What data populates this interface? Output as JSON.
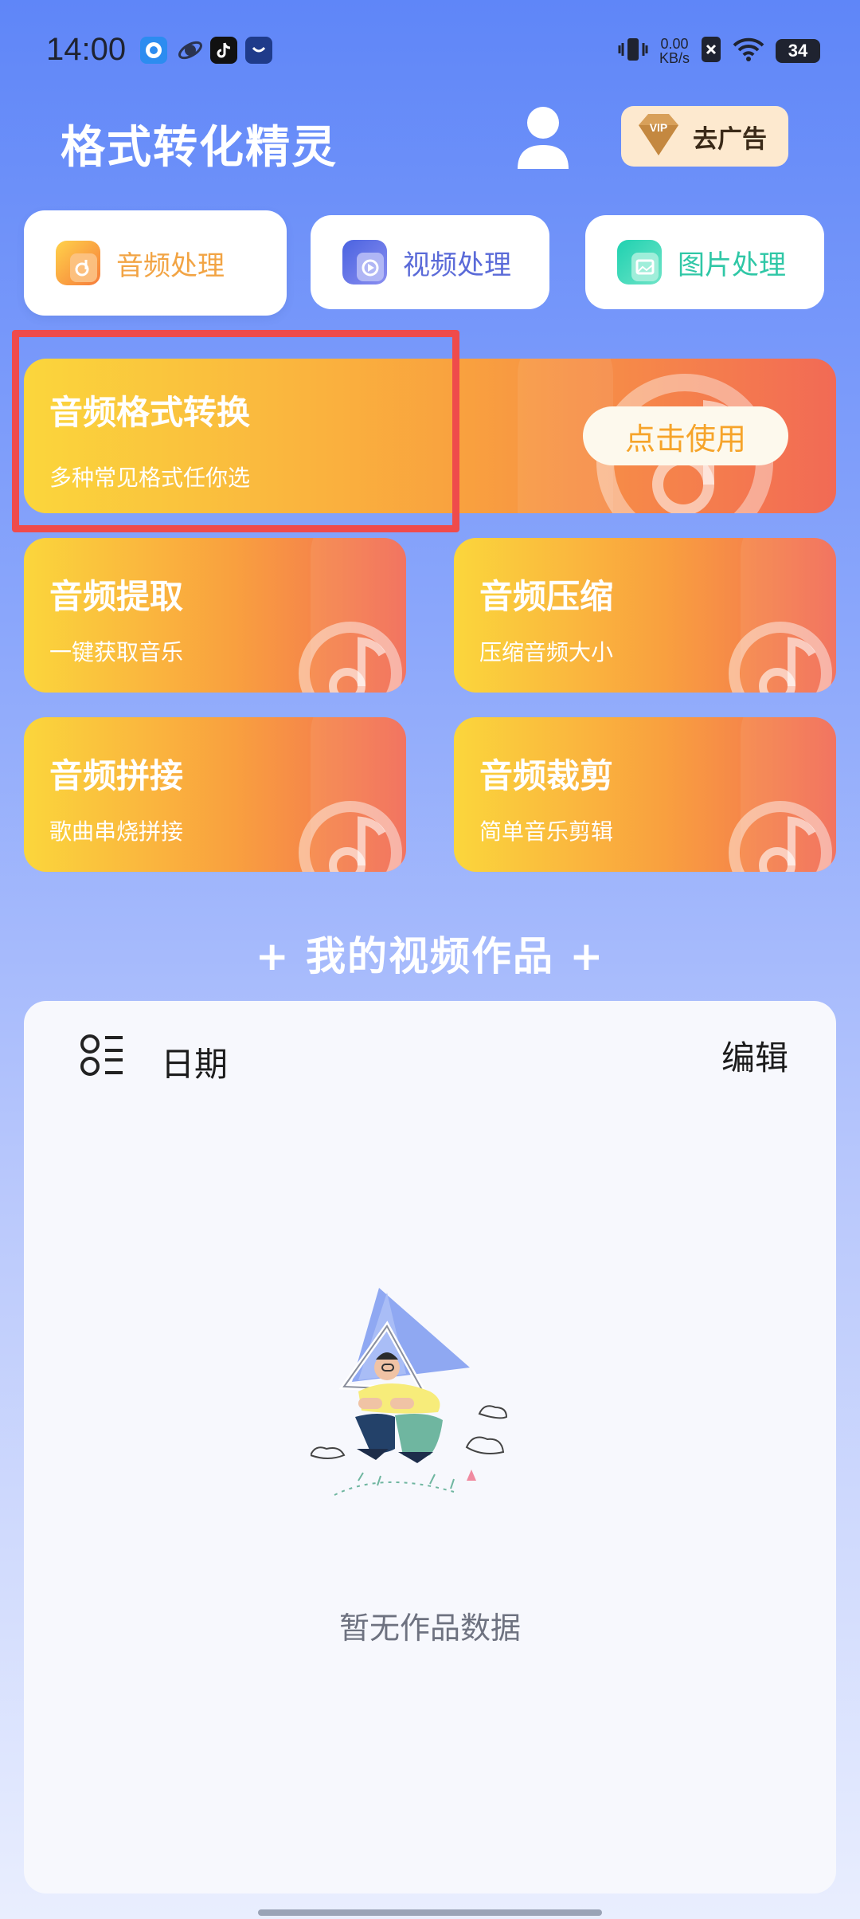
{
  "status_bar": {
    "time": "14:00",
    "net_speed_value": "0.00",
    "net_speed_unit": "KB/s",
    "battery": "34",
    "app_icons": [
      "qq-browser-icon",
      "planet-app-icon",
      "tiktok-icon",
      "shopping-bag-icon"
    ],
    "system_icons": [
      "vibrate-icon",
      "sim-off-icon",
      "wifi-icon"
    ]
  },
  "header": {
    "title": "格式转化精灵",
    "vip_badge": "VIP",
    "remove_ads_label": "去广告"
  },
  "tabs": [
    {
      "label": "音频处理",
      "active": true,
      "color": "#f2a444",
      "icon": "audio-file-icon"
    },
    {
      "label": "视频处理",
      "active": false,
      "color": "#5a6ad8",
      "icon": "video-file-icon"
    },
    {
      "label": "图片处理",
      "active": false,
      "color": "#2fc7a6",
      "icon": "image-file-icon"
    }
  ],
  "feature_main": {
    "title": "音频格式转换",
    "subtitle": "多种常见格式任你选",
    "button_label": "点击使用"
  },
  "features": [
    {
      "title": "音频提取",
      "subtitle": "一键获取音乐"
    },
    {
      "title": "音频压缩",
      "subtitle": "压缩音频大小"
    },
    {
      "title": "音频拼接",
      "subtitle": "歌曲串烧拼接"
    },
    {
      "title": "音频裁剪",
      "subtitle": "简单音乐剪辑"
    }
  ],
  "works": {
    "section_title": "+ 我的视频作品 +",
    "sort_label": "日期",
    "edit_label": "编辑",
    "empty_text": "暂无作品数据"
  },
  "colors": {
    "bg_top": "#5f86f8",
    "card_gradient_start": "#fbd63c",
    "card_gradient_end": "#f26a55",
    "highlight": "#ef4b4b"
  }
}
